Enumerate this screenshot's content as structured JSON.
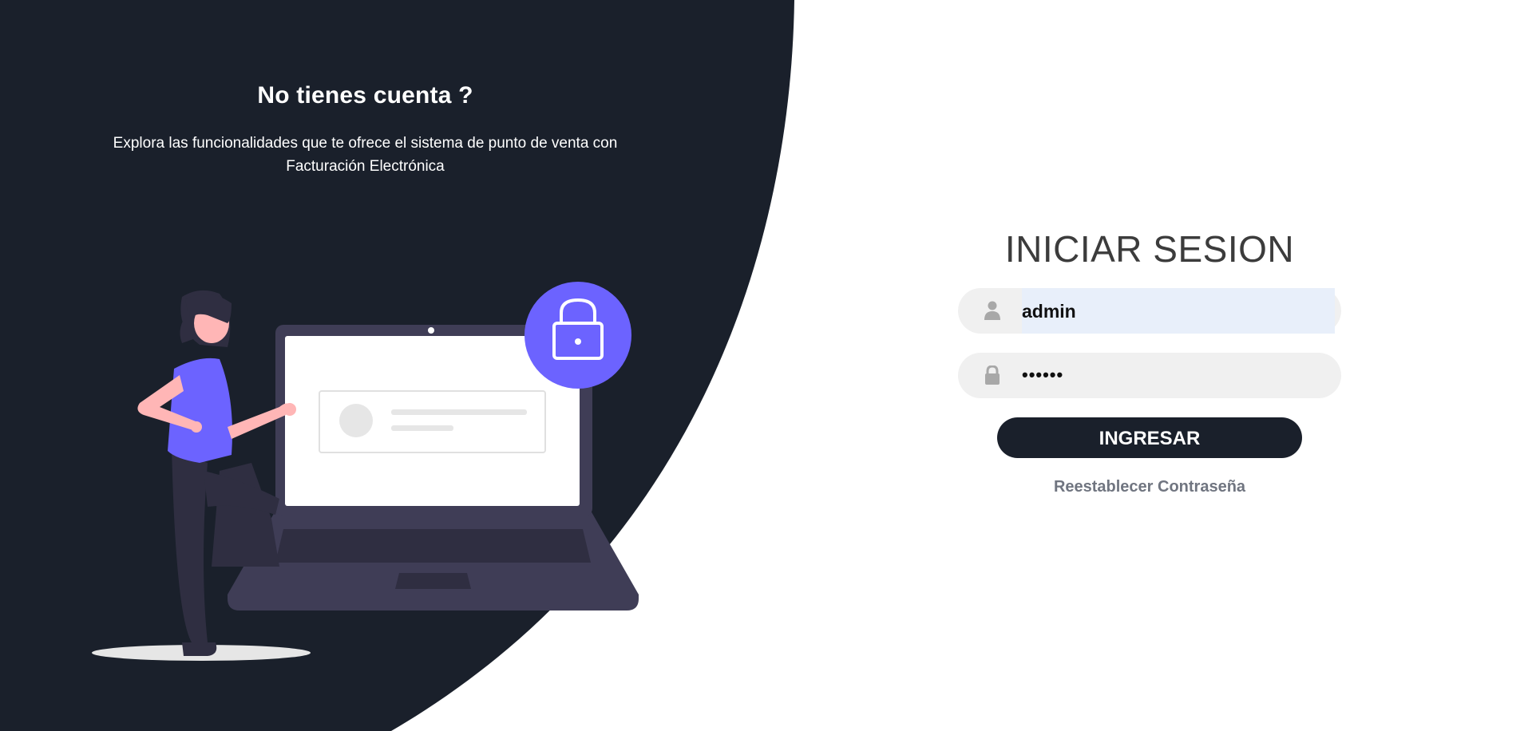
{
  "promo": {
    "title": "No tienes cuenta ?",
    "description": "Explora las funcionalidades que te ofrece el sistema de punto de venta con Facturación Electrónica"
  },
  "login": {
    "title": "INICIAR SESION",
    "username_value": "admin",
    "password_value": "••••••",
    "submit_label": "INGRESAR",
    "reset_label": "Reestablecer Contraseña"
  },
  "icons": {
    "username": "user-icon",
    "password": "lock-icon",
    "illustration_badge": "lock-icon"
  },
  "colors": {
    "dark_bg": "#1a202b",
    "accent": "#6c63ff",
    "field_bg": "#f0f0f0",
    "autofill_bg": "#e8effa",
    "button_bg": "#1a202b",
    "link": "#707580"
  }
}
